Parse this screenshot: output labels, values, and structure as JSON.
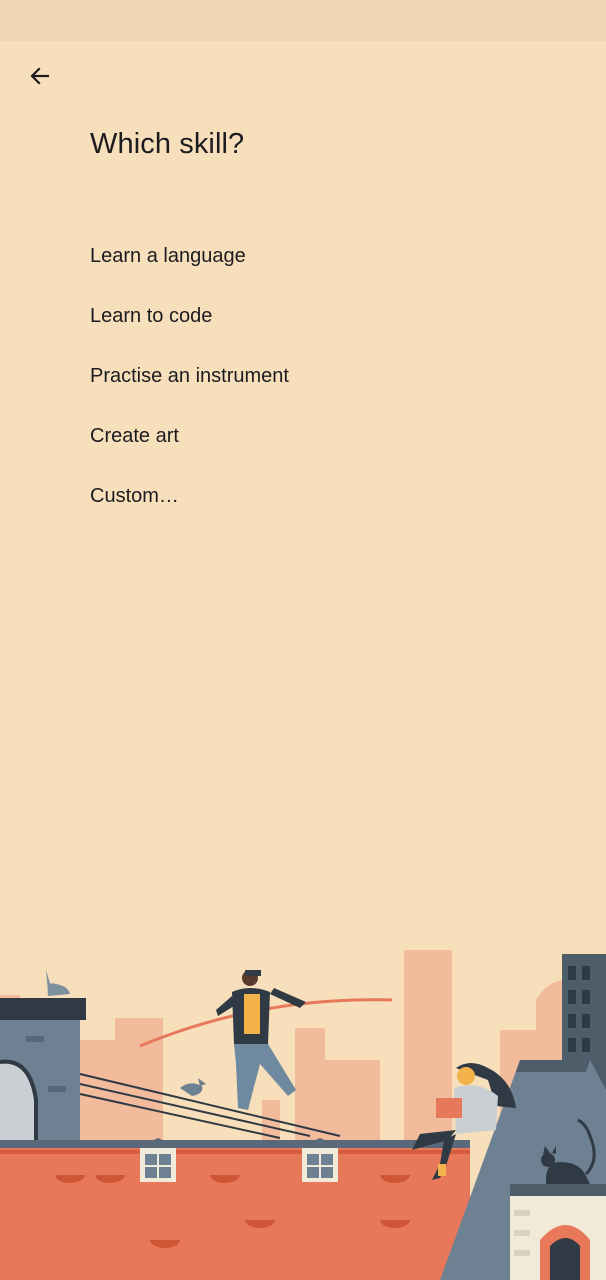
{
  "header": {
    "back_icon": "arrow-left-icon",
    "title": "Which skill?"
  },
  "options": [
    {
      "label": "Learn a language"
    },
    {
      "label": "Learn to code"
    },
    {
      "label": "Practise an instrument"
    },
    {
      "label": "Create art"
    },
    {
      "label": "Custom…"
    }
  ],
  "colors": {
    "background": "#f7dfbb",
    "status_bar": "#efd7b3",
    "roof": "#e8785a",
    "slate": "#5f7485"
  }
}
